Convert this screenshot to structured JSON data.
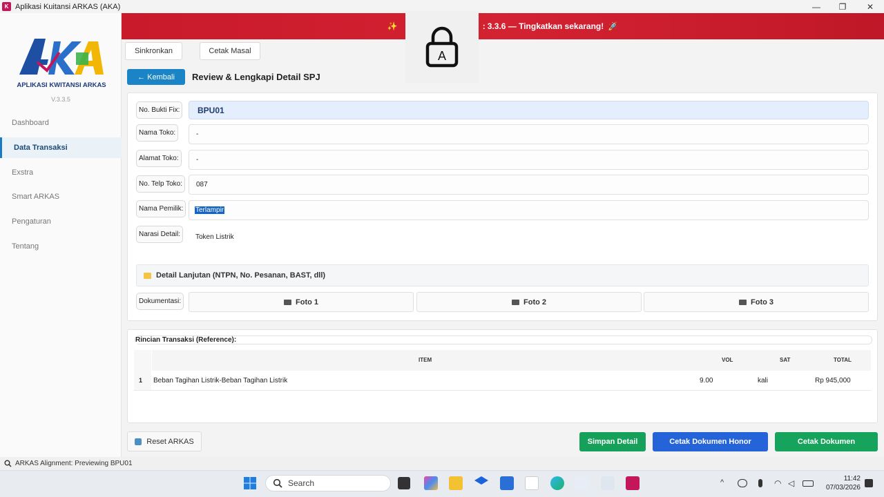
{
  "window": {
    "title": "Aplikasi Kuitansi ARKAS (AKA)",
    "app_icon_text": "K",
    "minimize": "—",
    "restore": "❐",
    "close": "✕"
  },
  "sidebar": {
    "logo_text": "AKA",
    "logo_subtitle": "APLIKASI KWITANSI ARKAS",
    "version": "V.3.3.5",
    "items": [
      {
        "label": "Dashboard",
        "active": false
      },
      {
        "label": "Data Transaksi",
        "active": true
      },
      {
        "label": "Exstra",
        "active": false
      },
      {
        "label": "Smart ARKAS",
        "active": false
      },
      {
        "label": "Pengaturan",
        "active": false
      },
      {
        "label": "Tentang",
        "active": false
      }
    ]
  },
  "banner": {
    "left_icon": "✨",
    "text": "3.3.6 — Tingkatkan sekarang!",
    "prefix_visible": ":",
    "right_icon": "🚀"
  },
  "toolbar": {
    "sync_label": "Sinkronkan",
    "print_bulk_label": "Cetak Masal"
  },
  "lock_overlay": {
    "letter": "A"
  },
  "header": {
    "back_label": "← Kembali",
    "title": "Review & Lengkapi Detail SPJ"
  },
  "form": {
    "fields": [
      {
        "label": "No. Bukti Fix:",
        "value": "BPU01"
      },
      {
        "label": "Nama Toko:",
        "value": "-"
      },
      {
        "label": "Alamat Toko:",
        "value": "-"
      },
      {
        "label": "No. Telp Toko:",
        "value": "087"
      },
      {
        "label": "Nama Pemilik:",
        "value": "Terlampir"
      },
      {
        "label": "Narasi Detail:",
        "value": "Token Listrik"
      }
    ],
    "detail_toggle": "Detail Lanjutan (NTPN, No. Pesanan, BAST, dll)",
    "doc_label": "Dokumentasi:",
    "photos": [
      "Foto 1",
      "Foto 2",
      "Foto 3"
    ]
  },
  "transactions": {
    "title": "Rincian Transaksi (Reference):",
    "columns": [
      "ITEM",
      "VOL",
      "SAT",
      "TOTAL"
    ],
    "rows": [
      {
        "no": "1",
        "item": "Beban Tagihan Listrik-Beban Tagihan Listrik",
        "vol": "9.00",
        "sat": "kali",
        "total": "Rp 945,000"
      }
    ]
  },
  "actions": {
    "reset_label": "Reset ARKAS",
    "save_label": "Simpan Detail",
    "honor_label": "Cetak Dokumen Honor",
    "print_label": "Cetak Dokumen",
    "colors": {
      "save": "#15a15a",
      "honor": "#2563d8",
      "print": "#16a35b"
    }
  },
  "status": {
    "text": "ARKAS Alignment: Previewing BPU01"
  },
  "taskbar": {
    "search_placeholder": "Search",
    "time": "11:42",
    "date": "07/03/2026"
  }
}
